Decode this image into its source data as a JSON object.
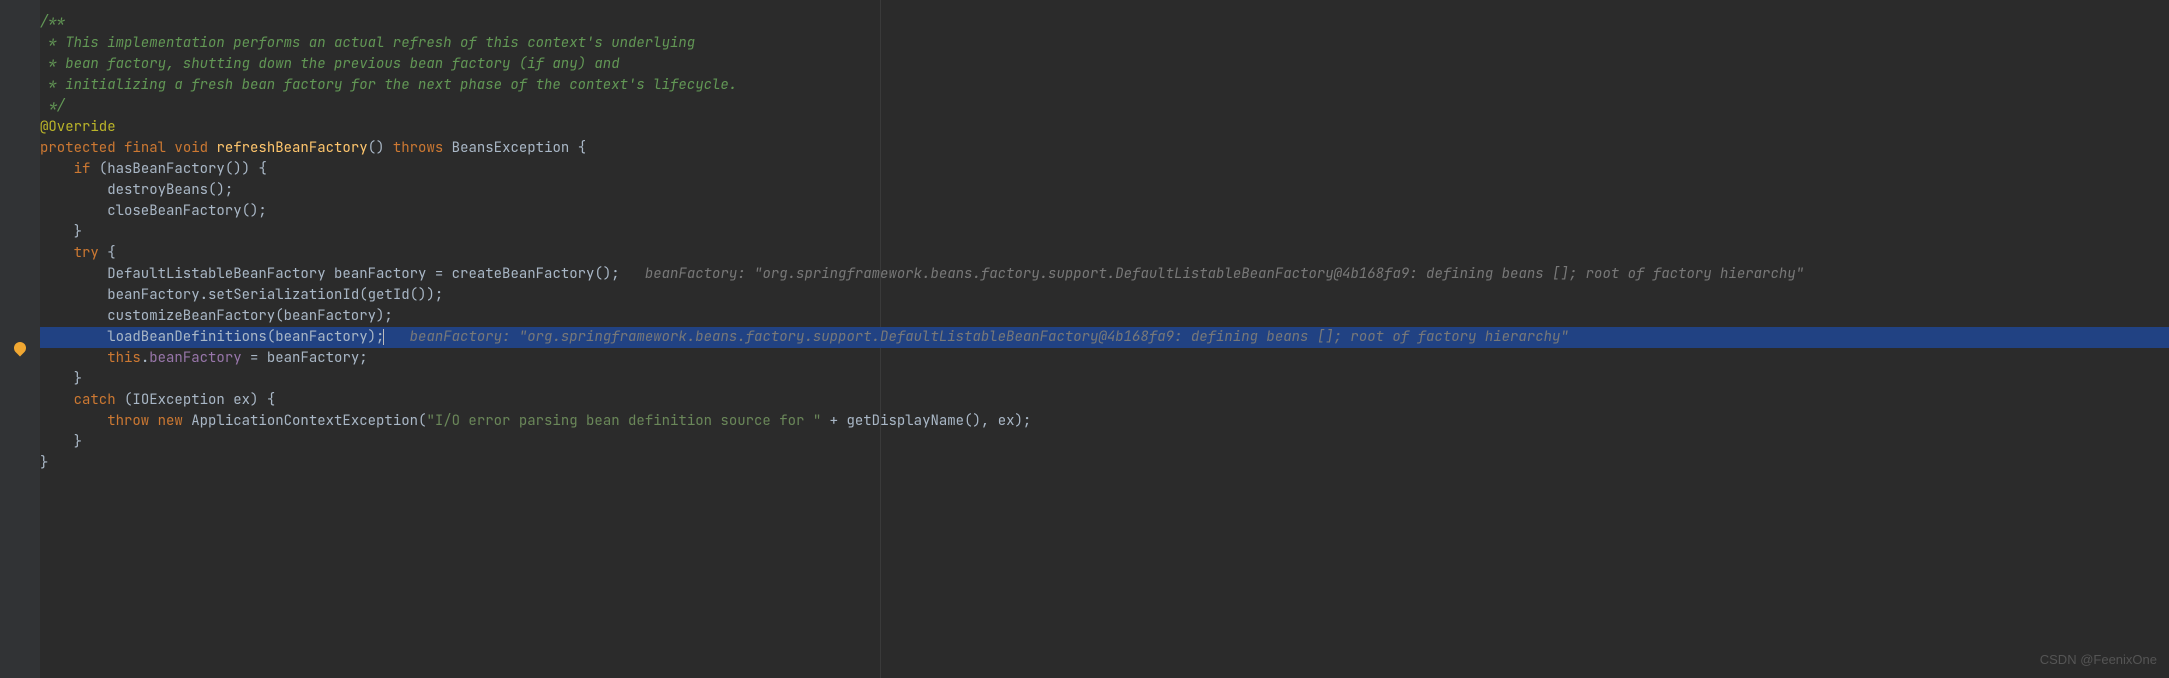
{
  "code": {
    "doc1": "/**",
    "doc2": " * This implementation performs an actual refresh of this context's underlying",
    "doc3": " * bean factory, shutting down the previous bean factory (if any) and",
    "doc4": " * initializing a fresh bean factory for the next phase of the context's lifecycle.",
    "doc5": " */",
    "annotation": "@Override",
    "kw_protected": "protected",
    "kw_final": "final",
    "kw_void": "void",
    "m_refreshBeanFactory": "refreshBeanFactory",
    "kw_throws": "throws",
    "t_BeansException": "BeansException",
    "kw_if": "if",
    "m_hasBeanFactory": "hasBeanFactory",
    "m_destroyBeans": "destroyBeans",
    "m_closeBeanFactory": "closeBeanFactory",
    "kw_try": "try",
    "t_DefaultListableBeanFactory": "DefaultListableBeanFactory",
    "v_beanFactory": "beanFactory",
    "m_createBeanFactory": "createBeanFactory",
    "hint1": "beanFactory: \"org.springframework.beans.factory.support.DefaultListableBeanFactory@4b168fa9: defining beans []; root of factory hierarchy\"",
    "m_setSerializationId": "setSerializationId",
    "m_getId": "getId",
    "m_customizeBeanFactory": "customizeBeanFactory",
    "m_loadBeanDefinitions": "loadBeanDefinitions",
    "hint2": "beanFactory: \"org.springframework.beans.factory.support.DefaultListableBeanFactory@4b168fa9: defining beans []; root of factory hierarchy\"",
    "kw_this": "this",
    "f_beanFactory": "beanFactory",
    "kw_catch": "catch",
    "t_IOException": "IOException",
    "v_ex": "ex",
    "kw_throw": "throw",
    "kw_new": "new",
    "t_ApplicationContextException": "ApplicationContextException",
    "str1": "\"I/O error parsing bean definition source for \"",
    "m_getDisplayName": "getDisplayName"
  },
  "watermark": "CSDN @FeenixOne"
}
